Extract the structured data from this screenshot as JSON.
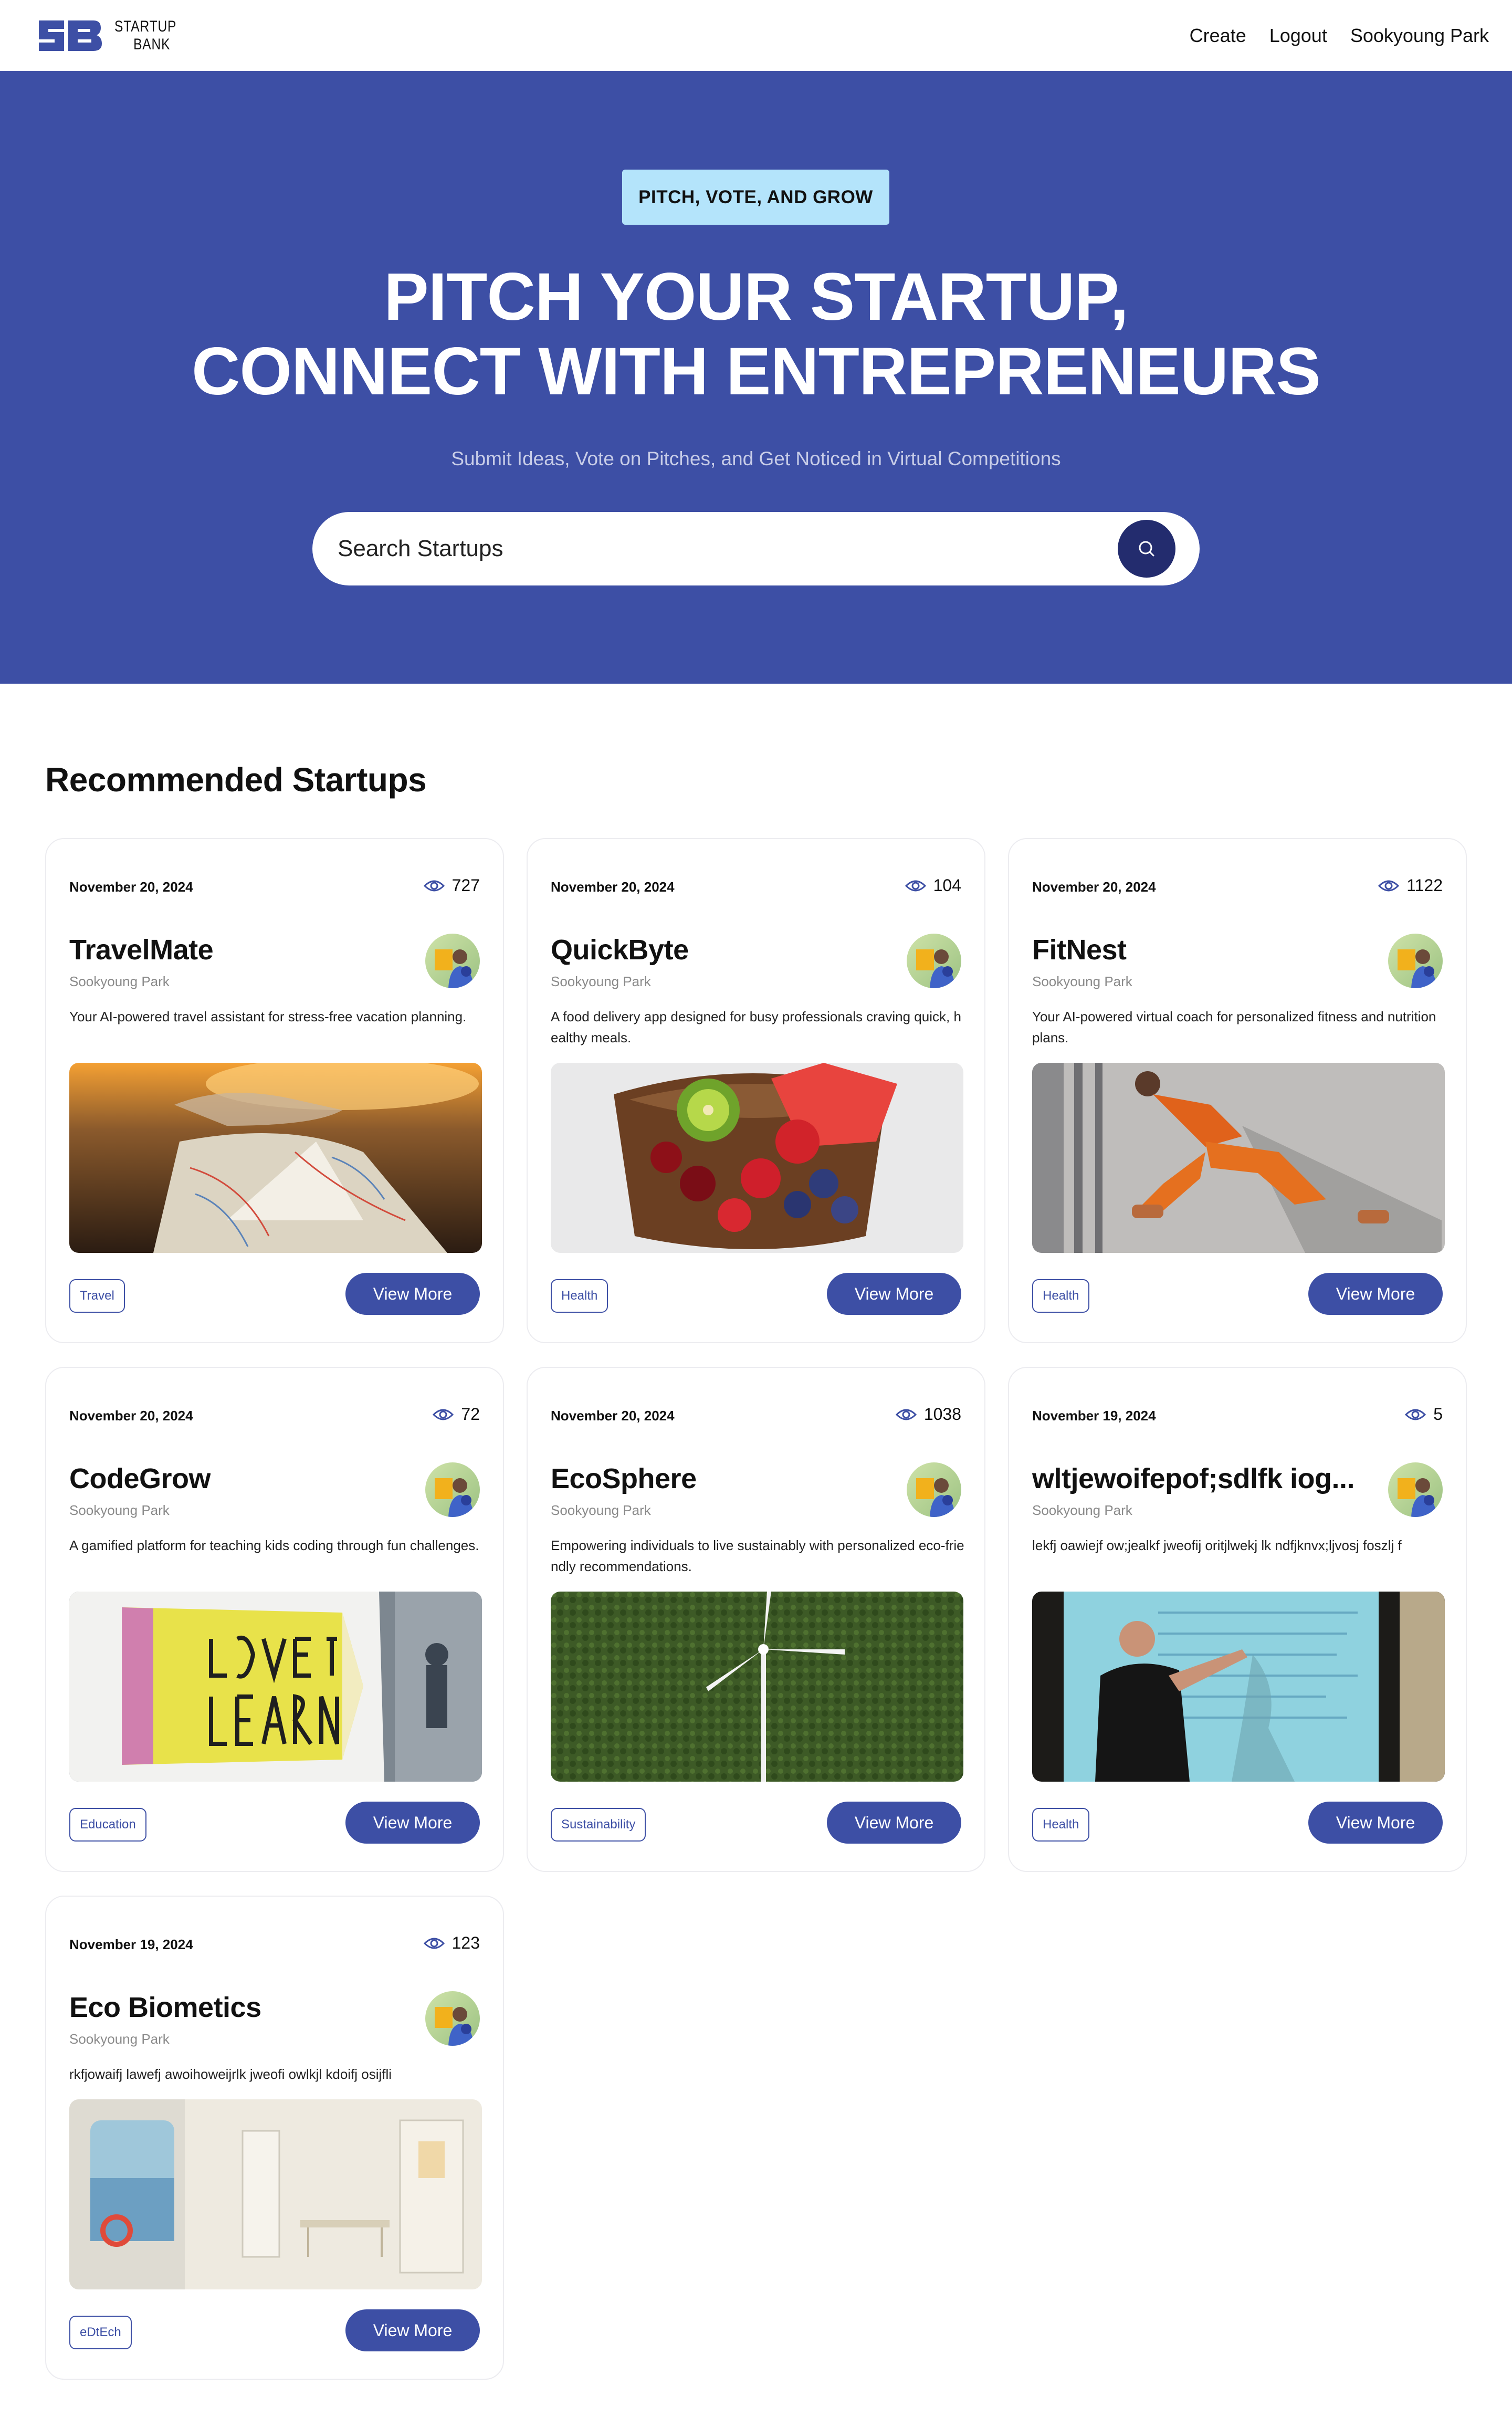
{
  "nav": {
    "brand_line1": "STARTUP",
    "brand_line2": "BANK",
    "links": [
      "Create",
      "Logout",
      "Sookyoung Park"
    ]
  },
  "hero": {
    "tag": "PITCH, VOTE, AND GROW",
    "title_line1": "PITCH YOUR STARTUP,",
    "title_line2": "CONNECT WITH ENTREPRENEURS",
    "subtitle": "Submit Ideas, Vote on Pitches, and Get Noticed in Virtual Competitions",
    "search_placeholder": "Search Startups"
  },
  "section": {
    "title": "Recommended Startups"
  },
  "colors": {
    "primary": "#3d4fa5",
    "dark_button": "#232c6e",
    "tag_bg": "#b4e4fb"
  },
  "cards": [
    {
      "date": "November 20, 2024",
      "views": "727",
      "name": "TravelMate",
      "author": "Sookyoung Park",
      "description": "Your AI-powered travel assistant for stress-free vacation planning.",
      "category": "Travel",
      "button": "View More",
      "image": "map-on-dashboard"
    },
    {
      "date": "November 20, 2024",
      "views": "104",
      "name": "QuickByte",
      "author": "Sookyoung Park",
      "description": "A food delivery app designed for busy professionals craving quick, healthy meals.",
      "category": "Health",
      "button": "View More",
      "image": "fruit-bowl"
    },
    {
      "date": "November 20, 2024",
      "views": "1122",
      "name": "FitNest",
      "author": "Sookyoung Park",
      "description": "Your AI-powered virtual coach for personalized fitness and nutrition plans.",
      "category": "Health",
      "button": "View More",
      "image": "woman-stretching"
    },
    {
      "date": "November 20, 2024",
      "views": "72",
      "name": "CodeGrow",
      "author": "Sookyoung Park",
      "description": "A gamified platform for teaching kids coding through fun challenges.",
      "category": "Education",
      "button": "View More",
      "image": "love-to-learn-pencil"
    },
    {
      "date": "November 20, 2024",
      "views": "1038",
      "name": "EcoSphere",
      "author": "Sookyoung Park",
      "description": "Empowering individuals to live sustainably with personalized eco-friendly recommendations.",
      "category": "Sustainability",
      "button": "View More",
      "image": "wind-turbine"
    },
    {
      "date": "November 19, 2024",
      "views": "5",
      "name": "wltjewoifepof;sdlfk iog...",
      "author": "Sookyoung Park",
      "description": "lekfj oawiejf ow;jealkf jweofij oritjlwekj lk ndfjknvx;ljvosj foszlj f",
      "category": "Health",
      "button": "View More",
      "image": "presenter-at-screen"
    },
    {
      "date": "November 19, 2024",
      "views": "123",
      "name": "Eco Biometics",
      "author": "Sookyoung Park",
      "description": "rkfjowaifj lawefj awoihoweijrlk jweofi owlkjl kdoifj osijfli",
      "category": "eDtEch",
      "button": "View More",
      "image": "white-room-interior"
    }
  ]
}
